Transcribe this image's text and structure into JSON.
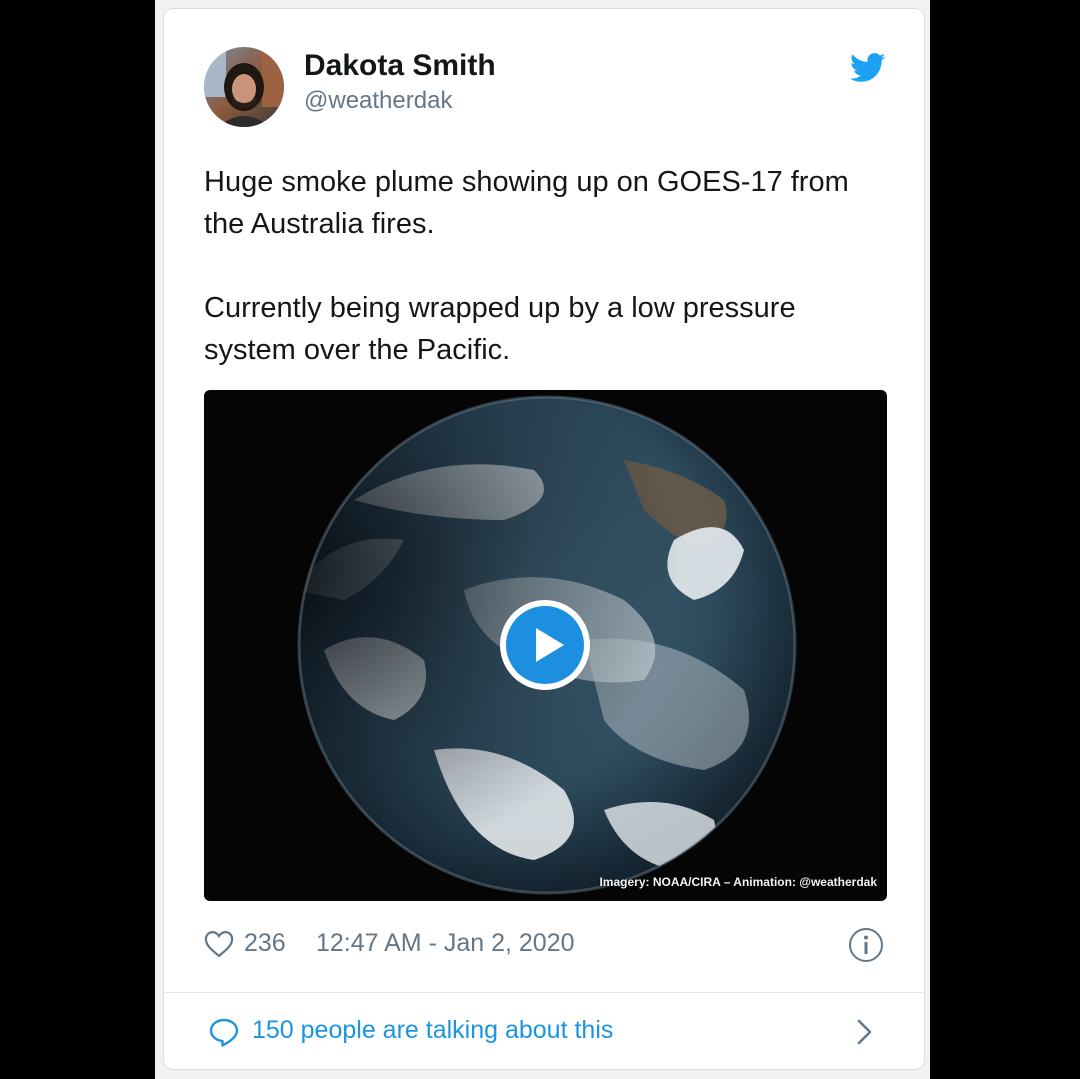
{
  "colors": {
    "brand": "#1da1f2",
    "link": "#1b95e0",
    "text": "#14171a",
    "muted": "#657786",
    "play": "#1d8fe0"
  },
  "user": {
    "name": "Dakota Smith",
    "handle": "@weatherdak",
    "avatar_icon": "profile-photo"
  },
  "tweet": {
    "paragraphs": [
      "Huge smoke plume showing up on GOES-17 from the Australia fires.",
      "Currently being wrapped up by a low pressure system over the Pacific."
    ]
  },
  "media": {
    "credit": "Imagery: NOAA/CIRA – Animation: @weatherdak",
    "play_icon": "play-icon"
  },
  "meta": {
    "likes": "236",
    "timestamp": "12:47 AM - Jan 2, 2020",
    "heart_icon": "heart-icon",
    "info_icon": "info-icon"
  },
  "footer": {
    "talking": "150 people are talking about this",
    "bubble_icon": "comment-bubble-icon",
    "chevron_icon": "chevron-right-icon"
  }
}
